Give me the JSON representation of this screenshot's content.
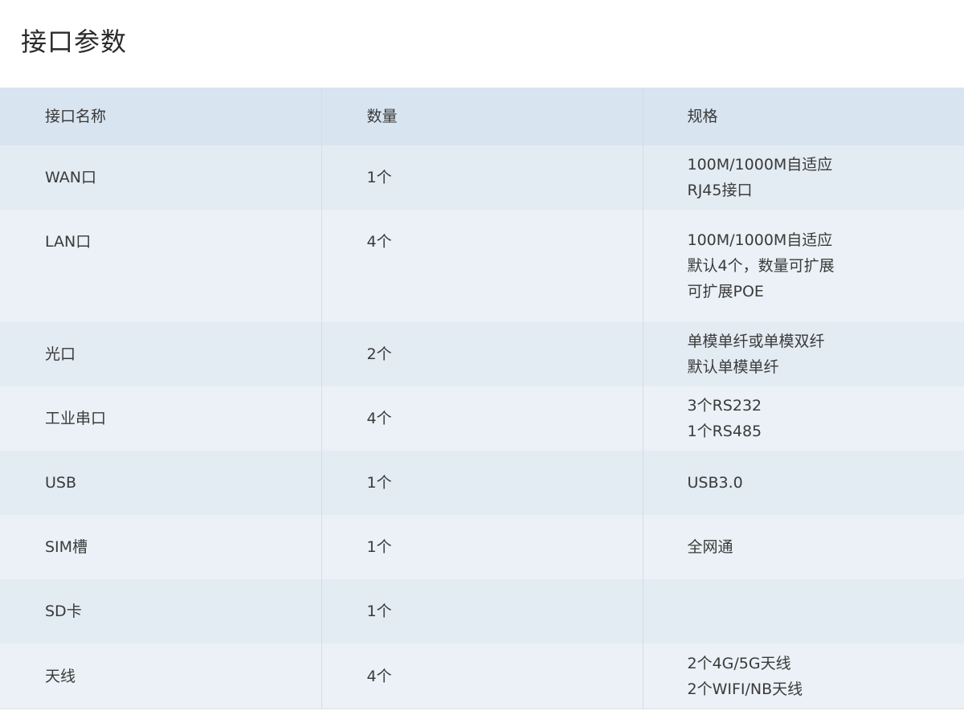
{
  "page": {
    "title": "接口参数"
  },
  "table": {
    "headers": [
      "接口名称",
      "数量",
      "规格"
    ],
    "rows": [
      {
        "name": "WAN口",
        "count": "1个",
        "spec": [
          "100M/1000M自适应",
          "RJ45接口"
        ]
      },
      {
        "name": "LAN口",
        "count": "4个",
        "spec": [
          "100M/1000M自适应",
          "默认4个，数量可扩展",
          "可扩展POE"
        ]
      },
      {
        "name": "光口",
        "count": "2个",
        "spec": [
          "单模单纤或单模双纤",
          "默认单模单纤"
        ]
      },
      {
        "name": "工业串口",
        "count": "4个",
        "spec": [
          "3个RS232",
          "1个RS485"
        ]
      },
      {
        "name": "USB",
        "count": "1个",
        "spec": [
          "USB3.0"
        ]
      },
      {
        "name": "SIM槽",
        "count": "1个",
        "spec": [
          "全网通"
        ]
      },
      {
        "name": "SD卡",
        "count": "1个",
        "spec": []
      },
      {
        "name": "天线",
        "count": "4个",
        "spec": [
          "2个4G/5G天线",
          "2个WIFI/NB天线"
        ]
      }
    ]
  }
}
